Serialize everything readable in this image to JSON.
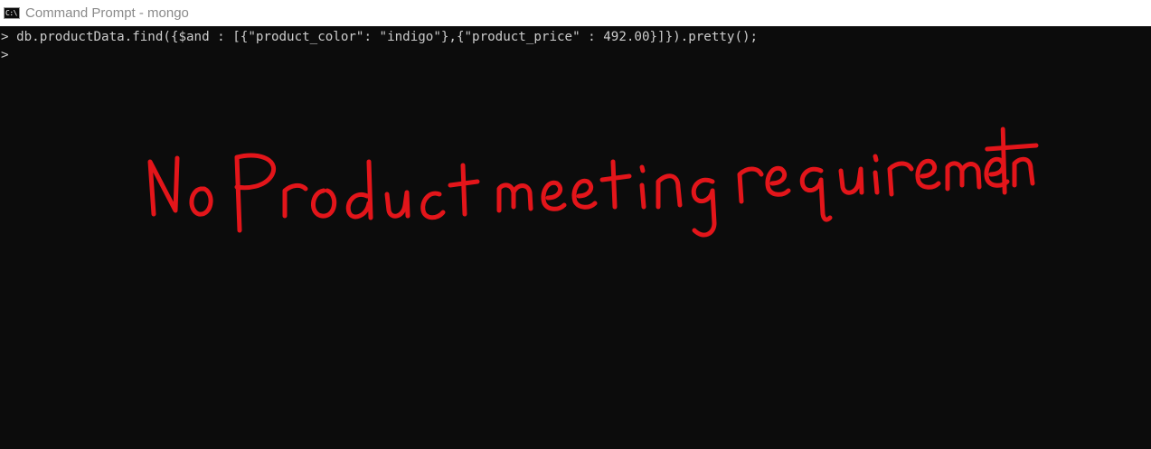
{
  "window": {
    "title": "Command Prompt - mongo",
    "icon": "cmd-icon",
    "icon_glyph": "C:\\"
  },
  "console": {
    "lines": [
      {
        "prompt": ">",
        "command": " db.productData.find({$and : [{\"product_color\": \"indigo\"},{\"product_price\" : 492.00}]}).pretty();"
      },
      {
        "prompt": ">",
        "command": ""
      }
    ]
  },
  "annotation": {
    "text": "No Product meeting requirement",
    "color": "#e3151a",
    "style": "handwritten"
  },
  "colors": {
    "background": "#0c0c0c",
    "foreground": "#cccccc",
    "titlebar": "#ffffff",
    "title_text": "#8a8a8a"
  }
}
